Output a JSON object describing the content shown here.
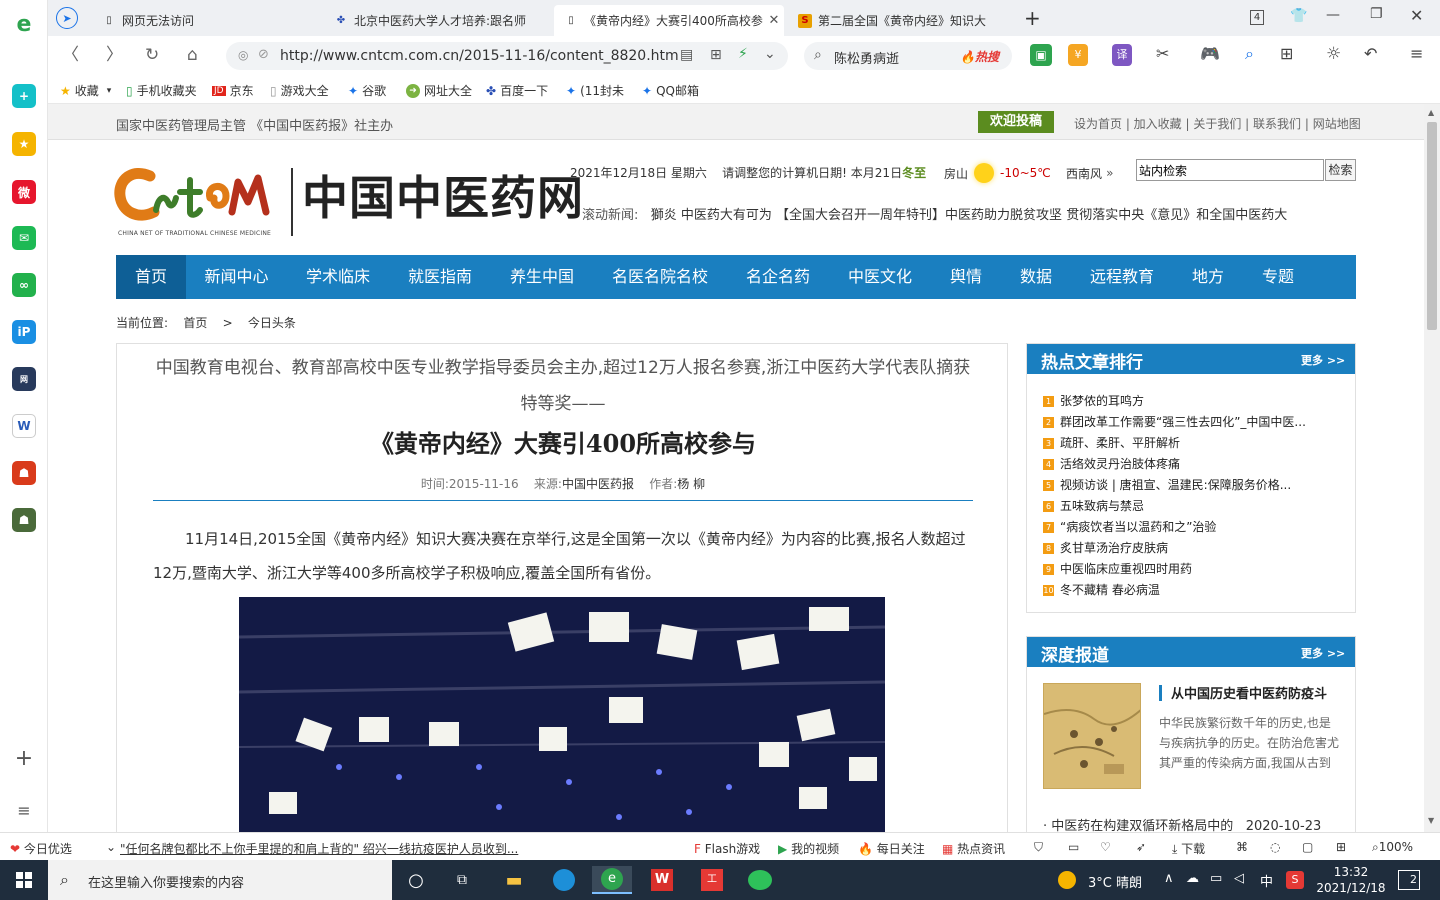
{
  "browser": {
    "tabs": [
      {
        "title": "网页无法访问"
      },
      {
        "title": "北京中医药大学人才培养:跟名师"
      },
      {
        "title": "《黄帝内经》大赛引400所高校参"
      },
      {
        "title": "第二届全国《黄帝内经》知识大"
      }
    ],
    "tab_count": "4",
    "url": "http://www.cntcm.com.cn/2015-11-16/content_8820.htm",
    "search_text": "陈松勇病逝",
    "search_hot": "热搜",
    "bookmarks": [
      "收藏",
      "手机收藏夹",
      "京东",
      "游戏大全",
      "谷歌",
      "网址大全",
      "百度一下",
      "(11封未",
      "QQ邮箱"
    ],
    "zoom": "100%"
  },
  "site": {
    "top_org": "国家中医药管理局主管 《中国中医药报》社主办",
    "submit_btn": "欢迎投稿",
    "top_links": "设为首页 | 加入收藏 | 关于我们 | 联系我们 | 网站地图",
    "logo_cn": "中国中医药网",
    "logo_en": "CHINA NET OF TRADITIONAL CHINESE MEDICINE",
    "date": "2021年12月18日 星期六",
    "date_note": "请调整您的计算机日期! 本月21日",
    "solar_term": "冬至",
    "weather_city": "房山",
    "weather_temp": "-10~5℃",
    "weather_wind": "西南风",
    "site_search_value": "站内检索",
    "site_search_btn": "检索",
    "scroll_label": "滚动新闻:",
    "scroll_news": "獅炎 中医药大有可为    【全国大会召开一周年特刊】中医药助力脱贫攻坚    贯彻落实中央《意见》和全国中医药大",
    "nav": [
      "首页",
      "新闻中心",
      "学术临床",
      "就医指南",
      "养生中国",
      "名医名院名校",
      "名企名药",
      "中医文化",
      "舆情",
      "数据",
      "远程教育",
      "地方",
      "专题"
    ],
    "crumb_label": "当前位置:",
    "crumb_home": "首页",
    "crumb_sep": ">",
    "crumb_cur": "今日头条"
  },
  "article": {
    "subtitle": "中国教育电视台、教育部高校中医专业教学指导委员会主办,超过12万人报名参赛,浙江中医药大学代表队摘获特等奖——",
    "title": "《黄帝内经》大赛引400所高校参与",
    "meta_time_label": "时间:",
    "meta_time": "2015-11-16",
    "meta_src_label": "来源:",
    "meta_src": "中国中医药报",
    "meta_author_label": "作者:",
    "meta_author": "杨 柳",
    "body": "11月14日,2015全国《黄帝内经》知识大赛决赛在京举行,这是全国第一次以《黄帝内经》为内容的比赛,报名人数超过12万,暨南大学、浙江大学等400多所高校学子积极响应,覆盖全国所有省份。"
  },
  "hot": {
    "title": "热点文章排行",
    "more": "更多 >>",
    "items": [
      "张梦侬的耳鸣方",
      "群团改革工作需要“强三性去四化”_中国中医...",
      "疏肝、柔肝、平肝解析",
      "活络效灵丹治肢体疼痛",
      "视频访谈 | 唐祖宣、温建民:保障服务价格...",
      "五味致病与禁忌",
      "“病痰饮者当以温药和之”治验",
      "炙甘草汤治疗皮肤病",
      "中医临床应重视四时用药",
      "冬不藏精 春必病温"
    ]
  },
  "deep": {
    "title": "深度报道",
    "more": "更多 >>",
    "feature_title": "从中国历史看中医药防疫斗",
    "feature_text": "中华民族繁衍数千年的历史,也是与疾病抗争的历史。在防治危害尤其严重的传染病方面,我国从古到",
    "news_title": "中医药在构建双循环新格局中的",
    "news_date": "2020-10-23"
  },
  "status": {
    "left_label": "今日优选",
    "news": "\"任何名牌包都比不上你手里提的和肩上背的\" 绍兴一线抗疫医护人员收到...",
    "items": [
      "Flash游戏",
      "我的视频",
      "每日关注",
      "热点资讯",
      "下载"
    ]
  },
  "taskbar": {
    "search_placeholder": "在这里输入你要搜索的内容",
    "weather": "3°C 晴朗",
    "ime": "中",
    "time": "13:32",
    "date": "2021/12/18",
    "notif": "2"
  },
  "colors": {
    "site_blue": "#1a7fc0",
    "submit_green": "#5b8c1f",
    "hot_red": "#e53935"
  }
}
